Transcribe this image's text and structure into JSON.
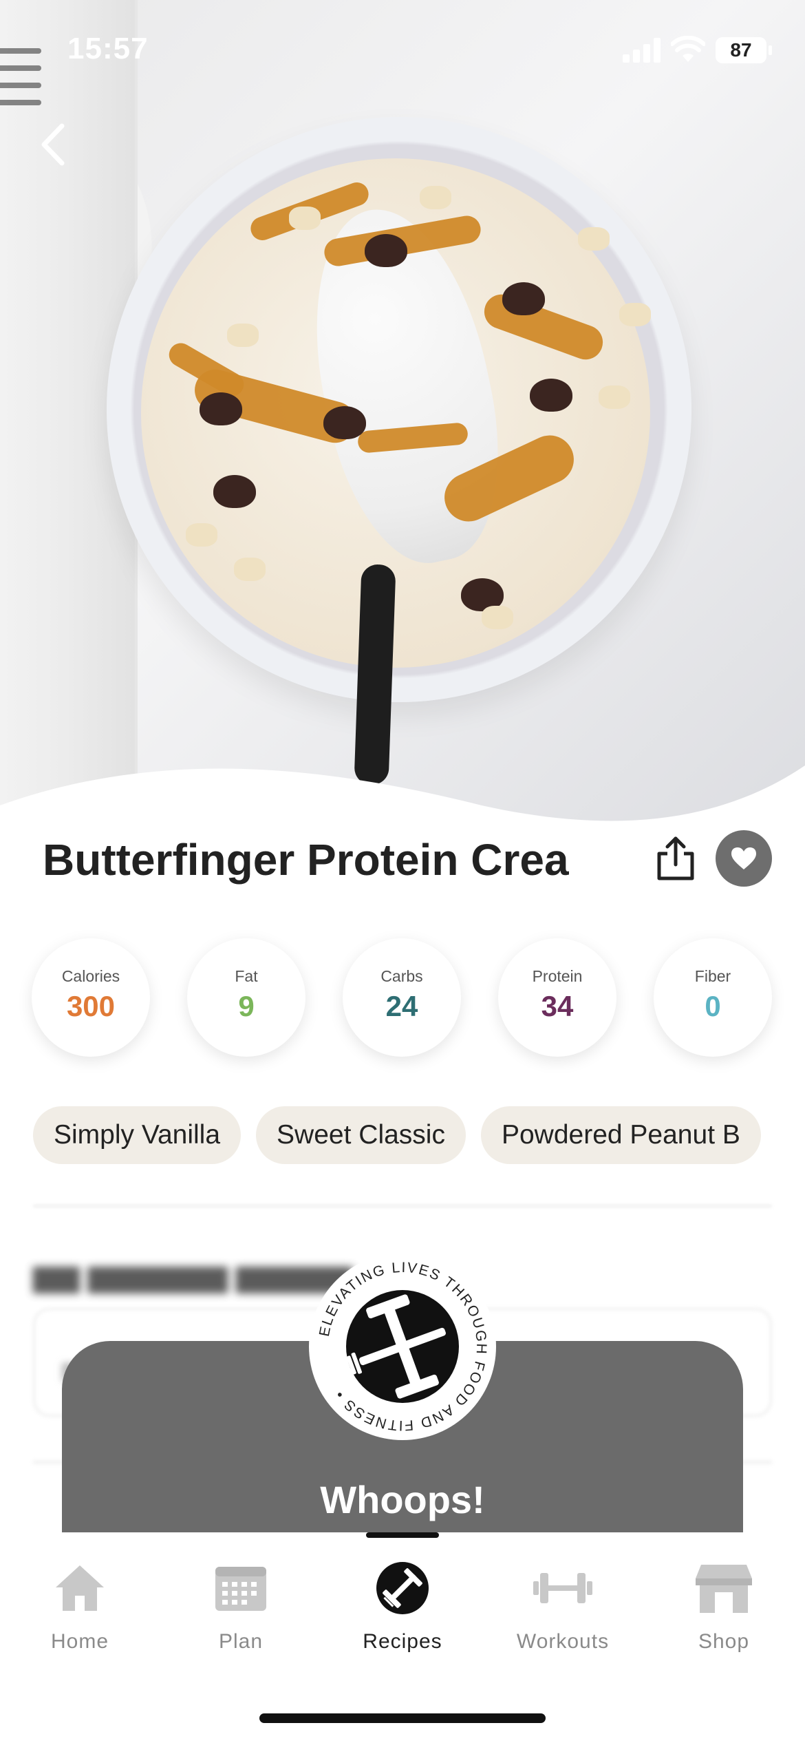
{
  "status_bar": {
    "time": "15:57",
    "battery": "87"
  },
  "recipe": {
    "title": "Butterfinger Protein Crea",
    "nutrition": [
      {
        "label": "Calories",
        "value": "300",
        "color": "#e07a36"
      },
      {
        "label": "Fat",
        "value": "9",
        "color": "#7bb65a"
      },
      {
        "label": "Carbs",
        "value": "24",
        "color": "#2e6e73"
      },
      {
        "label": "Protein",
        "value": "34",
        "color": "#6b2d5c"
      },
      {
        "label": "Fiber",
        "value": "0",
        "color": "#5bb3c3"
      }
    ],
    "tags": [
      "Simply Vanilla",
      "Sweet Classic",
      "Powdered Peanut B"
    ]
  },
  "modal": {
    "title": "Whoops!",
    "logo_text": "ELEVATING LIVES THROUGH FOOD AND FITNESS •"
  },
  "tabbar": {
    "items": [
      {
        "label": "Home",
        "icon": "home-icon",
        "active": false
      },
      {
        "label": "Plan",
        "icon": "calendar-icon",
        "active": false
      },
      {
        "label": "Recipes",
        "icon": "fork-dumbbell-icon",
        "active": true
      },
      {
        "label": "Workouts",
        "icon": "dumbbell-icon",
        "active": false
      },
      {
        "label": "Shop",
        "icon": "storefront-icon",
        "active": false
      }
    ]
  },
  "colors": {
    "accent_gray": "#6b6b6b",
    "tag_bg": "#f1ede6"
  }
}
